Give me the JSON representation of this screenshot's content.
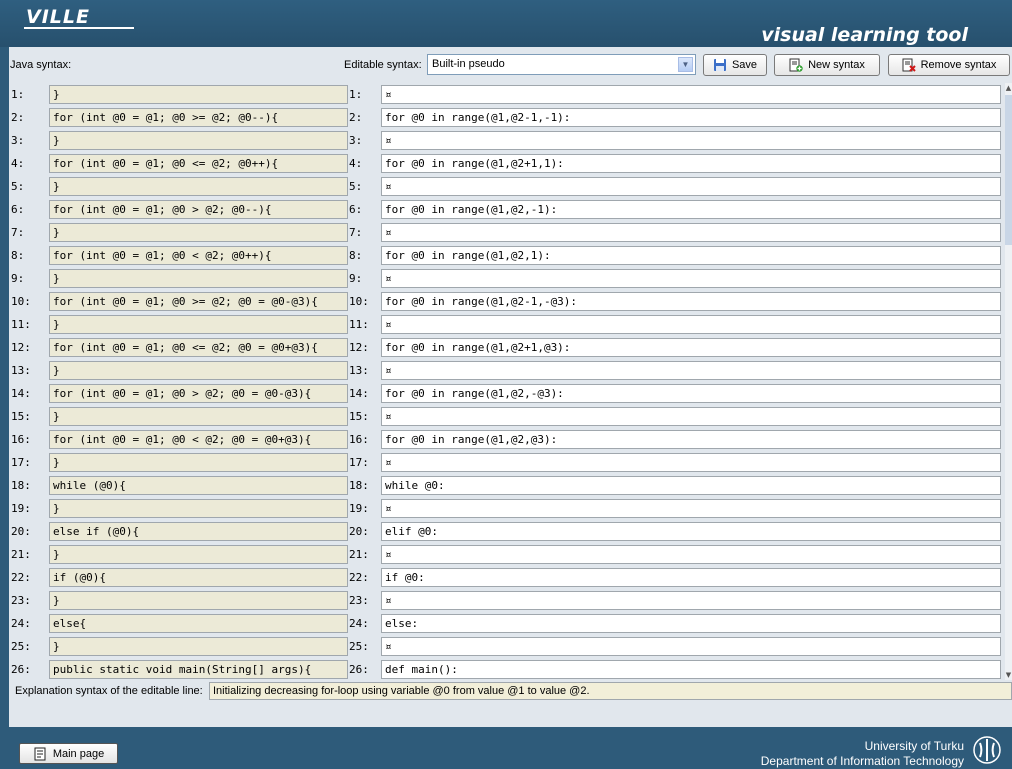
{
  "app": {
    "logo": "VILLE",
    "tagline": "visual learning tool"
  },
  "toolbar": {
    "java_label": "Java syntax:",
    "editable_label": "Editable syntax:",
    "syntax_select_value": "Built-in pseudo",
    "save_label": "Save",
    "new_syntax_label": "New syntax",
    "remove_syntax_label": "Remove syntax"
  },
  "rows": [
    {
      "n": "1:",
      "java": "}",
      "edit": "¤"
    },
    {
      "n": "2:",
      "java": "for (int @0 = @1; @0 >= @2; @0--){",
      "edit": "for @0 in range(@1,@2-1,-1):"
    },
    {
      "n": "3:",
      "java": "}",
      "edit": "¤"
    },
    {
      "n": "4:",
      "java": "for (int @0 = @1; @0 <= @2; @0++){",
      "edit": "for @0 in range(@1,@2+1,1):"
    },
    {
      "n": "5:",
      "java": "}",
      "edit": "¤"
    },
    {
      "n": "6:",
      "java": "for (int @0 = @1; @0 > @2; @0--){",
      "edit": "for @0 in range(@1,@2,-1):"
    },
    {
      "n": "7:",
      "java": "}",
      "edit": "¤"
    },
    {
      "n": "8:",
      "java": "for (int @0 = @1; @0 < @2; @0++){",
      "edit": "for @0 in range(@1,@2,1):"
    },
    {
      "n": "9:",
      "java": "}",
      "edit": "¤"
    },
    {
      "n": "10:",
      "java": "for (int @0 = @1; @0 >= @2; @0 = @0-@3){",
      "edit": "for @0 in range(@1,@2-1,-@3):"
    },
    {
      "n": "11:",
      "java": "}",
      "edit": "¤"
    },
    {
      "n": "12:",
      "java": "for (int @0 = @1; @0 <= @2; @0 = @0+@3){",
      "edit": "for @0 in range(@1,@2+1,@3):"
    },
    {
      "n": "13:",
      "java": "}",
      "edit": "¤"
    },
    {
      "n": "14:",
      "java": "for (int @0 = @1; @0 > @2; @0 = @0-@3){",
      "edit": "for @0 in range(@1,@2,-@3):"
    },
    {
      "n": "15:",
      "java": "}",
      "edit": "¤"
    },
    {
      "n": "16:",
      "java": "for (int @0 = @1; @0 < @2; @0 = @0+@3){",
      "edit": "for @0 in range(@1,@2,@3):"
    },
    {
      "n": "17:",
      "java": "}",
      "edit": "¤"
    },
    {
      "n": "18:",
      "java": "while (@0){",
      "edit": "while @0:"
    },
    {
      "n": "19:",
      "java": "}",
      "edit": "¤"
    },
    {
      "n": "20:",
      "java": "else if (@0){",
      "edit": "elif @0:"
    },
    {
      "n": "21:",
      "java": "}",
      "edit": "¤"
    },
    {
      "n": "22:",
      "java": "if (@0){",
      "edit": "if @0:"
    },
    {
      "n": "23:",
      "java": "}",
      "edit": "¤"
    },
    {
      "n": "24:",
      "java": "else{",
      "edit": "else:"
    },
    {
      "n": "25:",
      "java": "}",
      "edit": "¤"
    },
    {
      "n": "26:",
      "java": "public static void main(String[] args){",
      "edit": "def main():"
    }
  ],
  "explanation": {
    "label": "Explanation syntax of the editable line:",
    "value": "Initializing decreasing for-loop using variable @0 from value @1 to value @2."
  },
  "footer": {
    "main_page_label": "Main page",
    "university": "University of Turku",
    "department": "Department of Information Technology"
  }
}
